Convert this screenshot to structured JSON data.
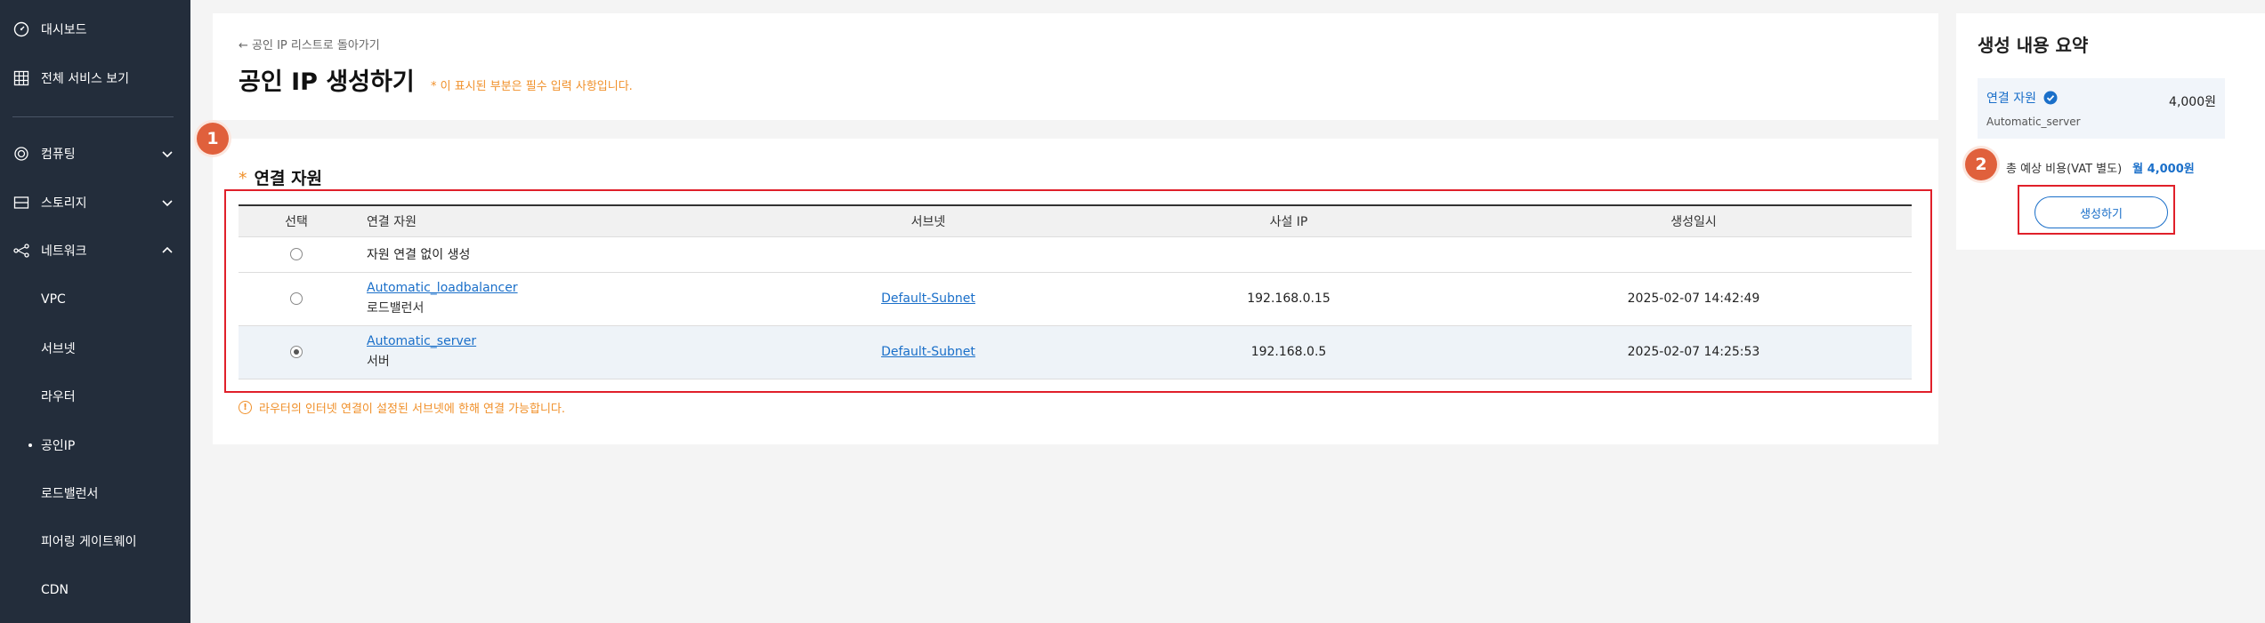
{
  "sidebar": {
    "items": [
      {
        "label": "대시보드",
        "icon": "dashboard-icon"
      },
      {
        "label": "전체 서비스 보기",
        "icon": "grid-icon"
      },
      {
        "label": "컴퓨팅",
        "icon": "cpu-icon"
      },
      {
        "label": "스토리지",
        "icon": "storage-icon"
      },
      {
        "label": "네트워크",
        "icon": "network-icon"
      }
    ],
    "sub_items": [
      {
        "label": "VPC"
      },
      {
        "label": "서브넷"
      },
      {
        "label": "라우터"
      },
      {
        "label": "공인IP",
        "active": true
      },
      {
        "label": "로드밸런서"
      },
      {
        "label": "피어링 게이트웨이"
      },
      {
        "label": "CDN"
      }
    ]
  },
  "header": {
    "back_link": "← 공인 IP 리스트로 돌아가기",
    "title": "공인 IP 생성하기",
    "required_note": "* 이 표시된 부분은 필수 입력 사항입니다."
  },
  "steps": {
    "step1": "1",
    "step2": "2"
  },
  "resource_section": {
    "star": "*",
    "title": "연결 자원",
    "columns": [
      "선택",
      "연결 자원",
      "서브넷",
      "사설 IP",
      "생성일시"
    ],
    "rows": [
      {
        "resource": "자원 연결 없이 생성",
        "type": "",
        "subnet": "",
        "private_ip": "",
        "created": "",
        "selected": false
      },
      {
        "resource": "Automatic_loadbalancer",
        "type": "로드밸런서",
        "subnet": "Default-Subnet",
        "private_ip": "192.168.0.15",
        "created": "2025-02-07 14:42:49",
        "selected": false
      },
      {
        "resource": "Automatic_server",
        "type": "서버",
        "subnet": "Default-Subnet",
        "private_ip": "192.168.0.5",
        "created": "2025-02-07 14:25:53",
        "selected": true
      }
    ],
    "info_note": "라우터의 인터넷 연결이 설정된 서브넷에 한해 연결 가능합니다."
  },
  "summary": {
    "title": "생성 내용 요약",
    "resource_label": "연결 자원",
    "resource_name": "Automatic_server",
    "resource_price": "4,000원",
    "total_label": "총 예상 비용(VAT 별도)",
    "total_amount": "월 4,000원",
    "create_button": "생성하기"
  },
  "colors": {
    "sidebar_bg": "#232d3b",
    "accent": "#1a6fc9",
    "warning": "#f0902a",
    "highlight": "#e0202a",
    "badge": "#e0603c"
  }
}
